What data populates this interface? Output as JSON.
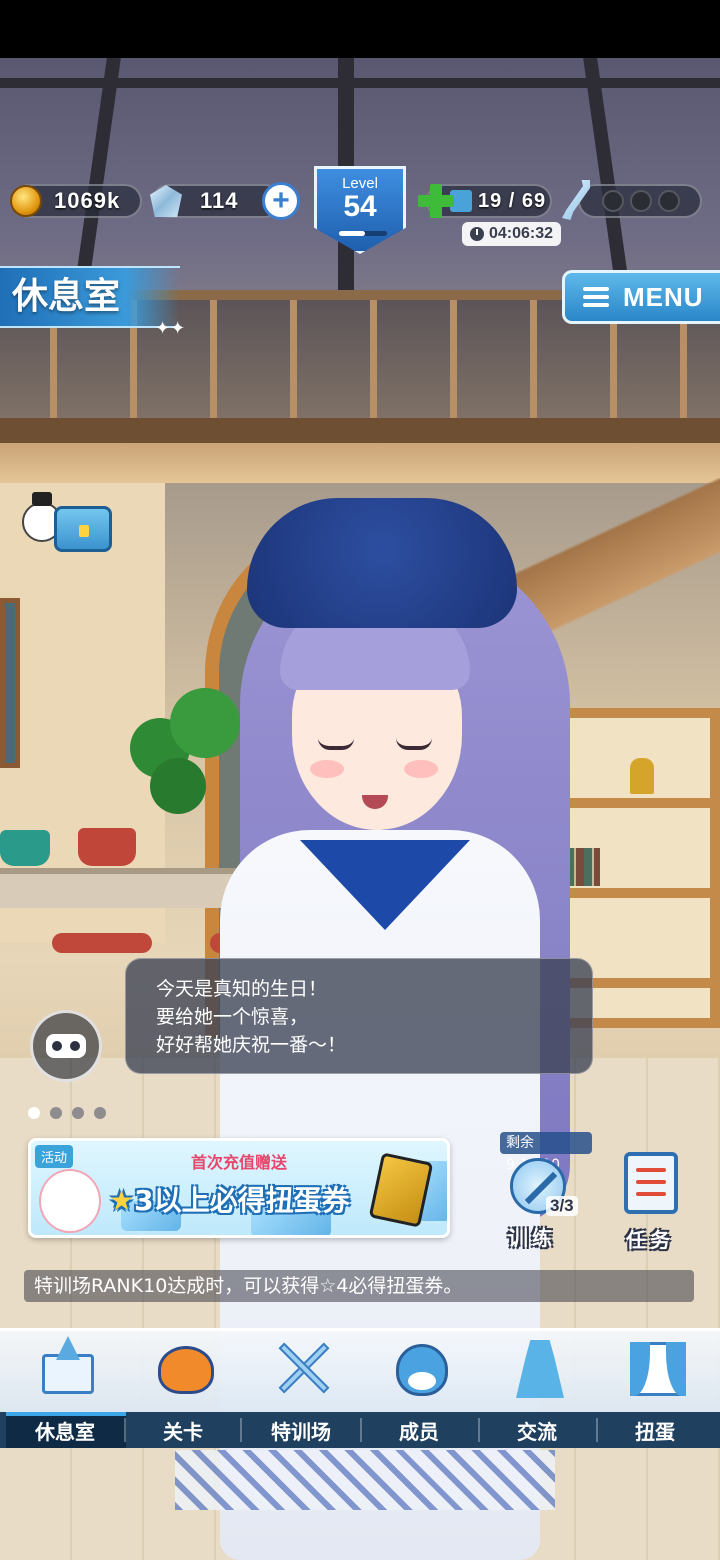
{
  "hud": {
    "coins": "1069k",
    "gems": "114",
    "plus": "+",
    "level_label": "Level",
    "level_value": "54",
    "level_progress": 0.55,
    "stamina": "19 / 69",
    "stamina_timer": "04:06:32"
  },
  "room": {
    "title": "休息室",
    "menu_label": "MENU"
  },
  "speech": {
    "lines": [
      "今天是真知的生日！",
      "要给她一个惊喜，",
      "好好帮她庆祝一番～！"
    ]
  },
  "banner": {
    "tag": "活动",
    "subtitle": "首次充值赠送",
    "main": "3以上必得扭蛋券"
  },
  "pager": {
    "count": 4,
    "active": 0
  },
  "training": {
    "remaining": "剩余9:16:10",
    "count": "3/3",
    "label": "训练"
  },
  "tasks": {
    "label": "任务"
  },
  "ticker": "特训场RANK10达成时，可以获得☆4必得扭蛋券。",
  "nav": {
    "items": [
      {
        "label": "休息室",
        "icon": "lounge-building-icon",
        "active": true
      },
      {
        "label": "关卡",
        "icon": "demon-mask-icon",
        "active": false
      },
      {
        "label": "特训场",
        "icon": "crossed-swords-icon",
        "active": false
      },
      {
        "label": "成员",
        "icon": "cat-face-icon",
        "active": false
      },
      {
        "label": "交流",
        "icon": "dress-icon",
        "active": false
      },
      {
        "label": "扭蛋",
        "icon": "curtain-stage-icon",
        "active": false
      }
    ]
  },
  "colors": {
    "accent_blue": "#2a86c9",
    "nav_dark": "#20405f",
    "speech_bg": "#3c4254"
  }
}
